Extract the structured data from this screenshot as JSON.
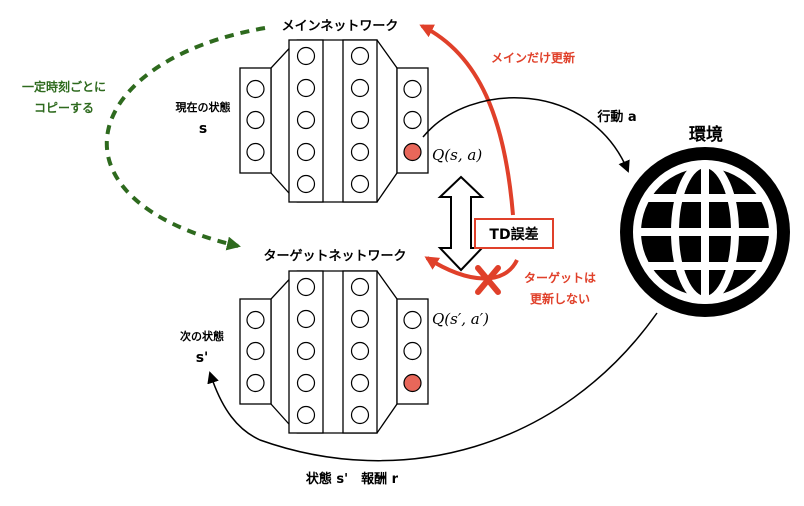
{
  "main_network": {
    "title": "メインネットワーク"
  },
  "target_network": {
    "title": "ターゲットネットワーク"
  },
  "current_state": {
    "line1": "現在の状態",
    "line2": "s"
  },
  "next_state": {
    "line1": "次の状態",
    "line2": "s'"
  },
  "q_main": "Q(s, a)",
  "q_target": "Q(s′, a′)",
  "copy_note": {
    "line1": "一定時刻ごとに",
    "line2": "コピーする"
  },
  "update_main_only": "メインだけ更新",
  "td_error": "TD誤差",
  "target_no_update": {
    "line1": "ターゲットは",
    "line2": "更新しない"
  },
  "action": "行動 a",
  "environment": "環境",
  "feedback": "状態 s'　報酬 r",
  "colors": {
    "red": "#e0402a",
    "green": "#2e6a1e",
    "selected_node": "#e8675a",
    "line": "#000000"
  },
  "icons": [
    "globe-icon",
    "cross-icon",
    "double-arrow-icon"
  ]
}
